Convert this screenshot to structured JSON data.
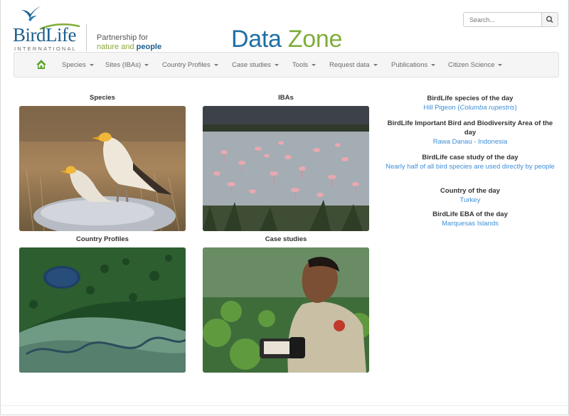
{
  "brand": {
    "logo_word": "BirdLife",
    "logo_sub": "INTERNATIONAL",
    "partner_line1": "Partnership for",
    "partner_line2a": "nature and ",
    "partner_line2b": "people",
    "site_title_a": "Data ",
    "site_title_b": "Zone",
    "colors": {
      "blue": "#1f6fa6",
      "green": "#7fae3a",
      "link": "#3e8ed8"
    }
  },
  "search": {
    "placeholder": "Search...",
    "icon": "search-icon"
  },
  "nav": {
    "home_icon": "home-icon",
    "items": [
      {
        "label": "Species"
      },
      {
        "label": "Sites (IBAs)"
      },
      {
        "label": "Country Profiles"
      },
      {
        "label": "Case studies"
      },
      {
        "label": "Tools"
      },
      {
        "label": "Request data"
      },
      {
        "label": "Publications"
      },
      {
        "label": "Citizen Science"
      }
    ]
  },
  "tiles": [
    {
      "title": "Species"
    },
    {
      "title": "IBAs"
    },
    {
      "title": "Country Profiles"
    },
    {
      "title": "Case studies"
    }
  ],
  "of_the_day": {
    "species": {
      "heading": "BirdLife species of the day",
      "name": "Hill Pigeon (",
      "sci": "Columba rupestris",
      "close": ")"
    },
    "iba": {
      "heading": "BirdLife Important Bird and Biodiversity Area of the day",
      "value": "Rawa Danau - Indonesia"
    },
    "case": {
      "heading": "BirdLife case study of the day",
      "value": "Nearly half of all bird species are used directly by people"
    },
    "country": {
      "heading": "Country of the day",
      "value": "Turkey"
    },
    "eba": {
      "heading": "BirdLife EBA of the day",
      "value": "Marquesas Islands"
    }
  }
}
